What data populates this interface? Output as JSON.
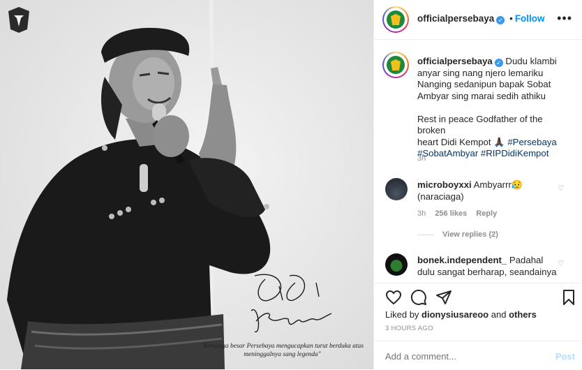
{
  "post_image": {
    "corner_logo_text": "PERSEBAYA",
    "signature": "Didi Kempot",
    "tagline": "\"Keluarga besar Persebaya mengucapkan turut berduka atas meninggalnya sang legenda\""
  },
  "header": {
    "username": "officialpersebaya",
    "separator": "•",
    "follow_label": "Follow",
    "more_icon": "more-horizontal-icon"
  },
  "caption": {
    "username": "officialpersebaya",
    "lines": [
      "Dudu klambi",
      "anyar sing nang njero lemariku",
      "Nanging sedanipun bapak Sobat",
      "Ambyar sing marai sedih athiku"
    ],
    "line5": "Rest in peace Godfather of the broken",
    "line6_pre": "heart Didi Kempot",
    "emoji": "🙏🏿",
    "hashtag1": "#Persebaya",
    "hashtag2": "#SobatAmbyar",
    "hashtag3": "#RIPDidiKempot",
    "time": "3h"
  },
  "comments": [
    {
      "username": "microboyxxi",
      "text_line1": "Ambyarrr😥",
      "text_line2": "(naraciaga)",
      "time": "3h",
      "likes": "256 likes",
      "reply": "Reply",
      "view_replies": "View replies (2)"
    },
    {
      "username": "bonek.independent_",
      "text_line1": "Padahal",
      "text_line2": "dulu sangat berharap, seandainya"
    }
  ],
  "actions": {
    "liked_by_prefix": "Liked by",
    "liked_by_user": "dionysiusareoo",
    "liked_by_and": "and",
    "liked_by_others": "others",
    "timestamp": "3 HOURS AGO"
  },
  "comment_input": {
    "placeholder": "Add a comment...",
    "post_label": "Post"
  },
  "colors": {
    "link_blue": "#0095f6",
    "hashtag": "#00376b",
    "muted": "#8e8e8e"
  }
}
